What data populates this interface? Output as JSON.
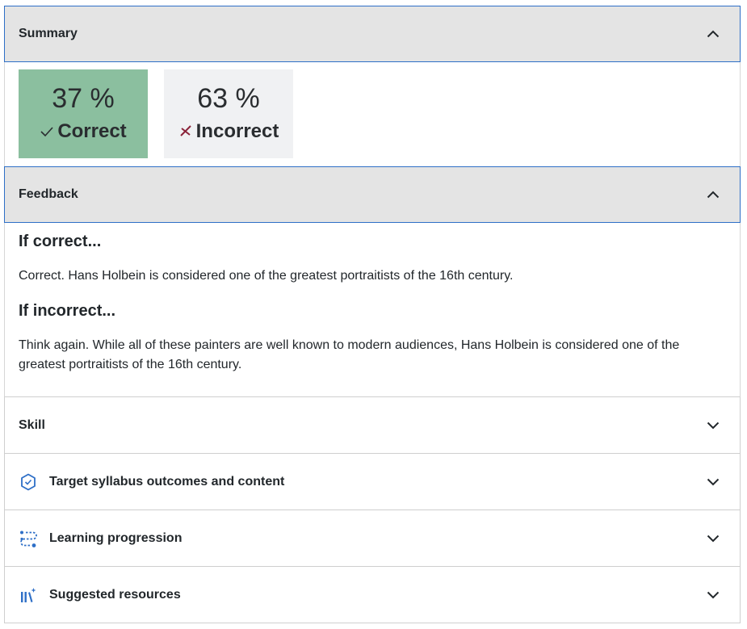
{
  "summary": {
    "title": "Summary",
    "correct": {
      "percent": "37 %",
      "label": "Correct"
    },
    "incorrect": {
      "percent": "63 %",
      "label": "Incorrect"
    }
  },
  "feedback": {
    "title": "Feedback",
    "if_correct_heading": "If correct...",
    "if_correct_text": "Correct. Hans Holbein is considered one of the greatest portraitists of the 16th century.",
    "if_incorrect_heading": "If incorrect...",
    "if_incorrect_text": "Think again. While all of these painters are well known to modern audiences, Hans Holbein is considered one of the greatest portraitists of the 16th century."
  },
  "sections": {
    "skill": "Skill",
    "target": "Target syllabus outcomes and content",
    "learning": "Learning progression",
    "resources": "Suggested resources"
  },
  "colors": {
    "correct_bg": "#8bbf9f",
    "incorrect_bg": "#f0f1f3",
    "accent_blue": "#2e6fc7",
    "incorrect_mark": "#8a2339"
  },
  "icons": {
    "summary_toggle": "chevron-up-icon",
    "feedback_toggle": "chevron-up-icon",
    "collapsed_toggle": "chevron-down-icon",
    "correct_mark": "check-icon",
    "incorrect_mark": "cross-icon",
    "target": "hexagon-check-icon",
    "learning": "progression-icon",
    "resources": "books-sparkle-icon"
  }
}
